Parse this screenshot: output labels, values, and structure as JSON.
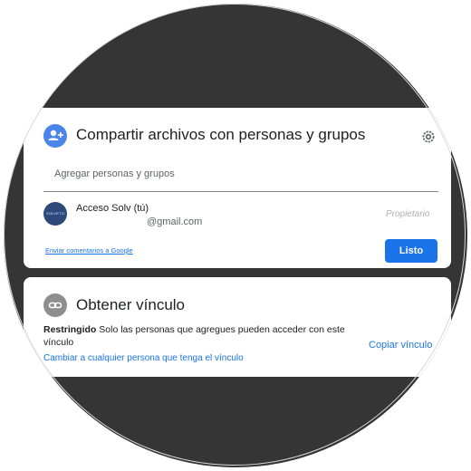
{
  "share_dialog": {
    "title": "Compartir archivos con personas y grupos",
    "icon": "add-person-icon",
    "settings_icon": "gear-icon",
    "input_placeholder": "Agregar personas y grupos",
    "user": {
      "avatar_text": "SOLVETIC",
      "name": "Acceso Solv (tú)",
      "email": "@gmail.com",
      "role": "Propietario"
    },
    "feedback_link": "Enviar comentarios a Google",
    "done_button": "Listo"
  },
  "link_dialog": {
    "title": "Obtener vínculo",
    "icon": "link-icon",
    "restriction_label": "Restringido",
    "restriction_text": "Solo las personas que agregues pueden acceder con este vínculo",
    "copy_link": "Copiar vínculo",
    "change_link": "Cambiar a cualquier persona que tenga el vínculo"
  },
  "colors": {
    "accent": "#1a73e8",
    "background": "#353535",
    "share_icon_bg": "#4a86e8",
    "link_icon_bg": "#8e8e8e"
  }
}
